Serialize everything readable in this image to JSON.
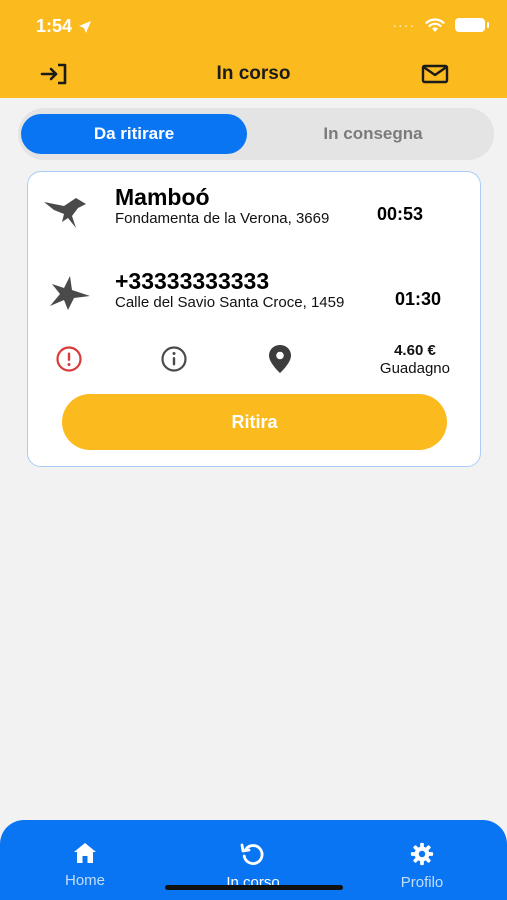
{
  "status": {
    "time": "1:54"
  },
  "header": {
    "title": "In corso"
  },
  "tabs": {
    "active": "Da ritirare",
    "inactive": "In consegna"
  },
  "order": {
    "pickup": {
      "name": "Mamboó",
      "address": "Fondamenta de la Verona, 3669",
      "time": "00:53"
    },
    "delivery": {
      "name": "+33333333333",
      "address": "Calle del Savio Santa Croce, 1459",
      "time": "01:30"
    },
    "earning": {
      "amount": "4.60 €",
      "label": "Guadagno"
    },
    "action_label": "Ritira"
  },
  "nav": {
    "items": [
      {
        "label": "Home",
        "icon": "home-icon"
      },
      {
        "label": "In corso",
        "icon": "history-icon"
      },
      {
        "label": "Profilo",
        "icon": "gear-icon"
      }
    ]
  },
  "colors": {
    "accent": "#fbbb1f",
    "primary": "#0a75f2",
    "alert": "#d93b3b"
  }
}
